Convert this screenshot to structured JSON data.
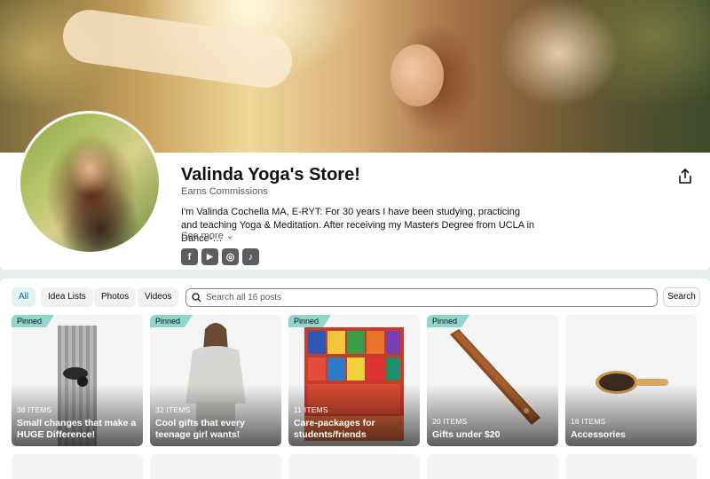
{
  "store": {
    "title": "Valinda Yoga's Store!",
    "earns": "Earns Commissions",
    "bio": "I'm Valinda Cochella MA, E-RYT: For 30 years I have been studying, practicing and teaching Yoga & Meditation. After receiving my Masters Degree from UCLA in Dance-…",
    "see_more": "See more",
    "social": [
      {
        "name": "facebook-icon",
        "glyph": "f"
      },
      {
        "name": "youtube-icon",
        "glyph": "▶"
      },
      {
        "name": "instagram-icon",
        "glyph": "◎"
      },
      {
        "name": "tiktok-icon",
        "glyph": "♪"
      }
    ]
  },
  "filters": [
    "All",
    "Idea Lists",
    "Photos",
    "Videos"
  ],
  "search": {
    "placeholder": "Search all 16 posts",
    "button": "Search"
  },
  "tiles": [
    {
      "pinned": "Pinned",
      "count": "38 ITEMS",
      "name": "Small changes that make a HUGE Difference!"
    },
    {
      "pinned": "Pinned",
      "count": "32 ITEMS",
      "name": "Cool gifts that every teenage girl wants!"
    },
    {
      "pinned": "Pinned",
      "count": "11 ITEMS",
      "name": "Care-packages for students/friends"
    },
    {
      "pinned": "Pinned",
      "count": "20 ITEMS",
      "name": "Gifts under $20"
    },
    {
      "pinned": "",
      "count": "16 ITEMS",
      "name": "Accessories"
    }
  ],
  "colors": {
    "accent": "#007185",
    "pinned": "#8fd6cf",
    "page_bg": "#eaeded"
  }
}
